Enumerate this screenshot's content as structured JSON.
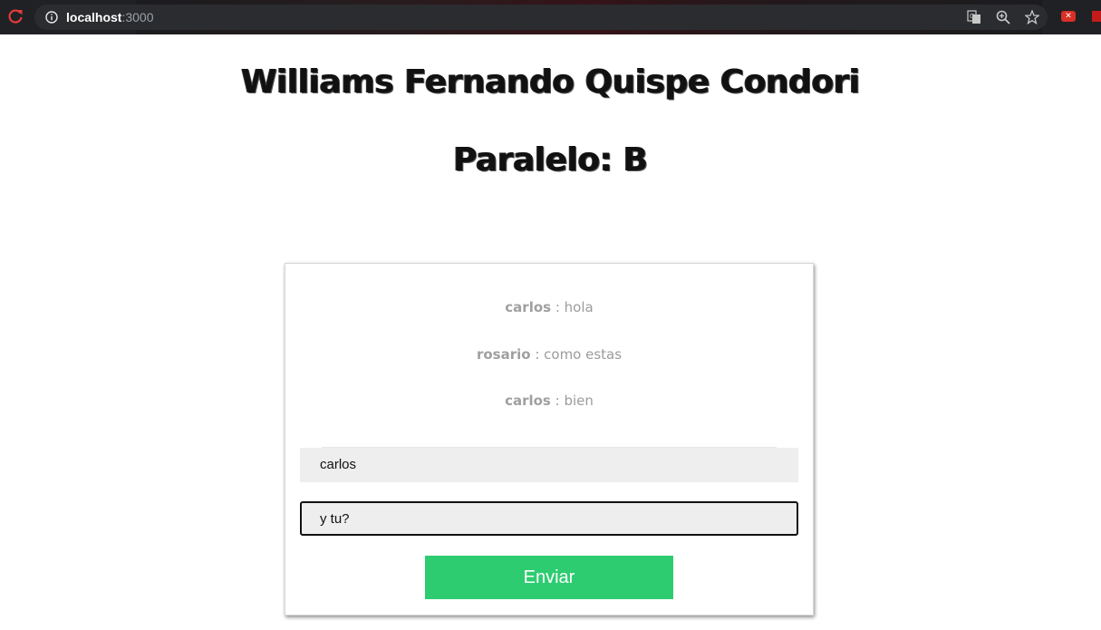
{
  "browser": {
    "url_host": "localhost",
    "url_port": ":3000"
  },
  "page": {
    "title": "Williams Fernando Quispe Condori",
    "subtitle": "Paralelo: B"
  },
  "chat": {
    "messages": [
      {
        "user": "carlos",
        "separator": " : ",
        "text": "hola"
      },
      {
        "user": "rosario",
        "separator": " : ",
        "text": "como estas"
      },
      {
        "user": "carlos",
        "separator": " : ",
        "text": "bien"
      }
    ],
    "username_value": "carlos",
    "message_value": "y tu?",
    "send_label": "Enviar"
  },
  "colors": {
    "send_button": "#2ecc71",
    "input_bg": "#eeeeee",
    "message_text": "#9c9c9c"
  }
}
